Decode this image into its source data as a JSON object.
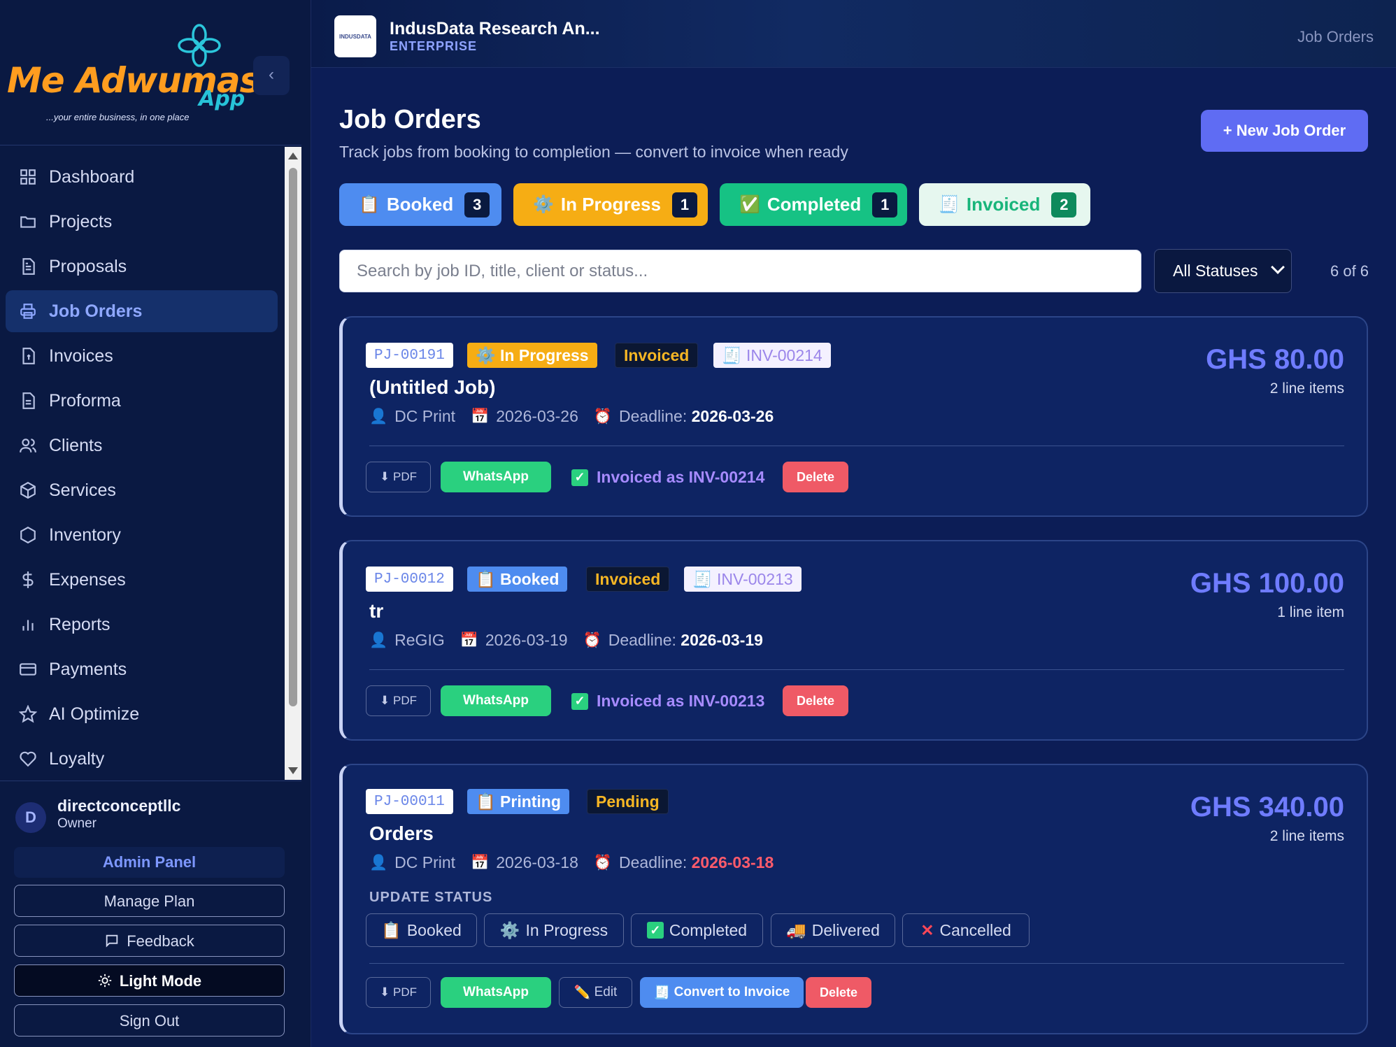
{
  "brand": {
    "name": "Me Adwumaso",
    "app": "App",
    "tagline": "...your entire business, in one place"
  },
  "sidebar": {
    "collapse": "‹",
    "items": [
      {
        "label": "Dashboard",
        "icon": "grid-icon"
      },
      {
        "label": "Projects",
        "icon": "folder-icon"
      },
      {
        "label": "Proposals",
        "icon": "document-icon"
      },
      {
        "label": "Job Orders",
        "icon": "printer-icon",
        "active": true
      },
      {
        "label": "Invoices",
        "icon": "invoice-icon"
      },
      {
        "label": "Proforma",
        "icon": "document-icon"
      },
      {
        "label": "Clients",
        "icon": "users-icon"
      },
      {
        "label": "Services",
        "icon": "box-icon"
      },
      {
        "label": "Inventory",
        "icon": "hexagon-icon"
      },
      {
        "label": "Expenses",
        "icon": "dollar-icon"
      },
      {
        "label": "Reports",
        "icon": "bar-chart-icon"
      },
      {
        "label": "Payments",
        "icon": "card-icon"
      },
      {
        "label": "AI Optimize",
        "icon": "star-icon"
      },
      {
        "label": "Loyalty",
        "icon": "heart-icon"
      }
    ],
    "user": {
      "initial": "D",
      "name": "directconceptllc",
      "role": "Owner"
    },
    "admin_panel": "Admin Panel",
    "manage_plan": "Manage Plan",
    "feedback": "Feedback",
    "light_mode": "Light Mode",
    "sign_out": "Sign Out"
  },
  "header": {
    "org_logo": "INDUSDATA",
    "org_name": "IndusData Research An...",
    "plan": "ENTERPRISE",
    "breadcrumb": "Job Orders"
  },
  "main": {
    "title": "Job Orders",
    "subtitle": "Track jobs from booking to completion — convert to invoice when ready",
    "new_button": "+ New Job Order",
    "pills": [
      {
        "label": "Booked",
        "count": "3",
        "icon": "📋"
      },
      {
        "label": "In Progress",
        "count": "1",
        "icon": "⚙️"
      },
      {
        "label": "Completed",
        "count": "1",
        "icon": "✅"
      },
      {
        "label": "Invoiced",
        "count": "2",
        "icon": "🧾"
      }
    ],
    "search_placeholder": "Search by job ID, title, client or status...",
    "status_filter": "All Statuses",
    "result_count": "6 of 6"
  },
  "jobs": [
    {
      "id": "PJ-00191",
      "status": "⚙️ In Progress",
      "billing": "Invoiced",
      "invoice_ref": "🧾 INV-00214",
      "title": "(Untitled Job)",
      "client": "DC Print",
      "date": "2026-03-26",
      "deadline_label": "Deadline:",
      "deadline": "2026-03-26",
      "amount": "GHS 80.00",
      "line_items": "2 line items",
      "pdf": "⬇ PDF",
      "whatsapp": "WhatsApp",
      "invoiced_note": "Invoiced as INV-00214",
      "delete": "Delete"
    },
    {
      "id": "PJ-00012",
      "status": "📋 Booked",
      "billing": "Invoiced",
      "invoice_ref": "🧾 INV-00213",
      "title": "tr",
      "client": "ReGIG",
      "date": "2026-03-19",
      "deadline_label": "Deadline:",
      "deadline": "2026-03-19",
      "amount": "GHS 100.00",
      "line_items": "1 line item",
      "pdf": "⬇ PDF",
      "whatsapp": "WhatsApp",
      "invoiced_note": "Invoiced as INV-00213",
      "delete": "Delete"
    },
    {
      "id": "PJ-00011",
      "status": "📋 Printing",
      "billing": "Pending",
      "title": "Orders",
      "client": "DC Print",
      "date": "2026-03-18",
      "deadline_label": "Deadline:",
      "deadline": "2026-03-18",
      "amount": "GHS 340.00",
      "line_items": "2 line items",
      "update_status_label": "UPDATE STATUS",
      "status_buttons": [
        "Booked",
        "In Progress",
        "Completed",
        "Delivered",
        "Cancelled"
      ],
      "pdf": "⬇ PDF",
      "whatsapp": "WhatsApp",
      "edit": "Edit",
      "convert": "Convert to Invoice",
      "delete": "Delete"
    }
  ],
  "colors": {
    "accent": "#5f6cf3",
    "booked": "#4e8cf0",
    "in_progress": "#f6ad14",
    "completed": "#16c284",
    "danger": "#ef5a66",
    "whatsapp": "#2ad07f"
  }
}
